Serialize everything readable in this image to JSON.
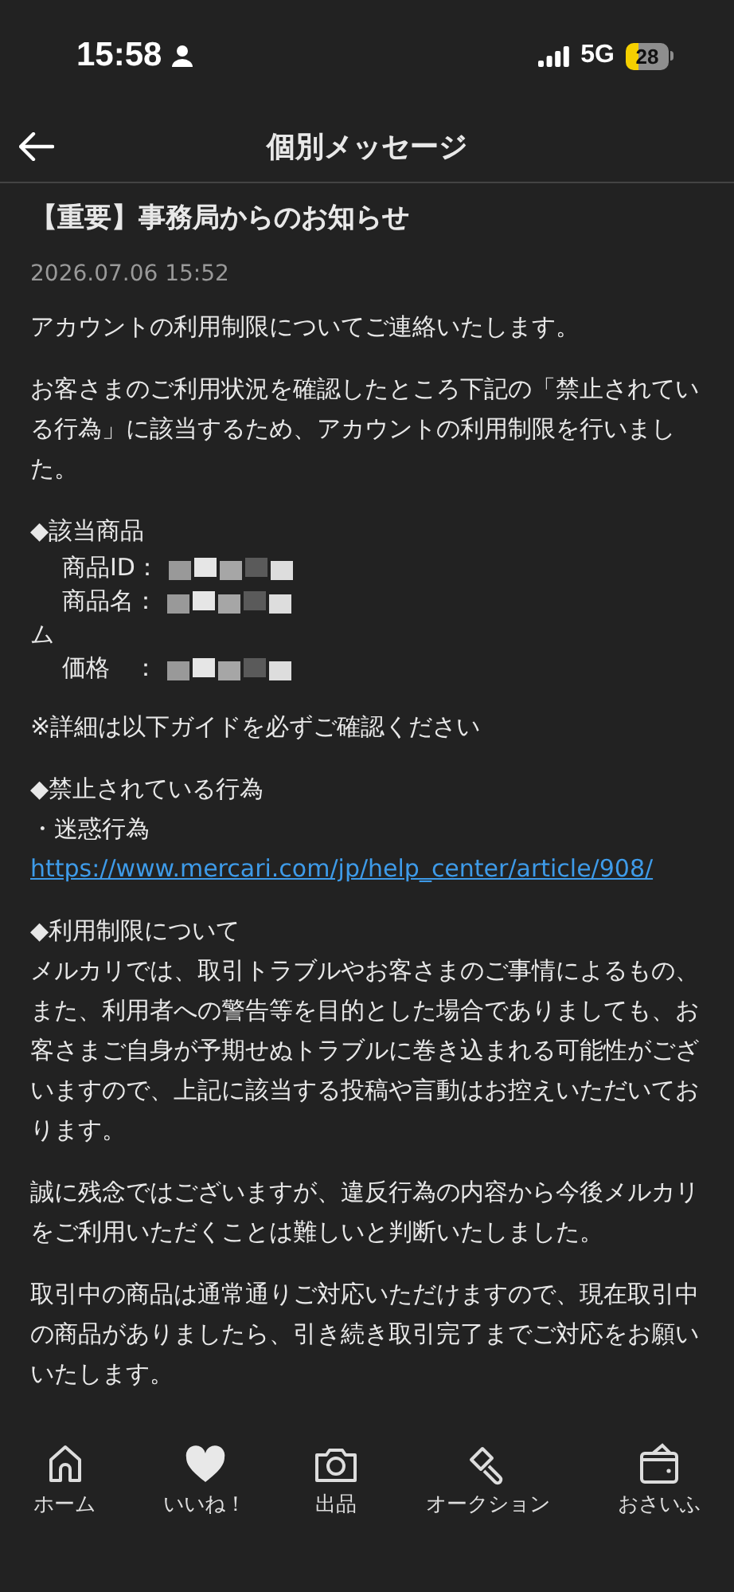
{
  "status_bar": {
    "time": "15:58",
    "network": "5G",
    "battery": "28"
  },
  "header": {
    "title": "個別メッセージ"
  },
  "message": {
    "title": "【重要】事務局からのお知らせ",
    "date": "2026.07.06 15:52",
    "blocks": [
      {
        "kind": "paragraph",
        "text": "アカウントの利用制限についてご連絡いたします。"
      },
      {
        "kind": "paragraph",
        "text": "お客さまのご利用状況を確認したところ下記の「禁止されている行為」に該当するため、アカウントの利用制限を行いました。"
      },
      {
        "kind": "details",
        "heading": "◆該当商品",
        "rows": [
          {
            "kind": "field",
            "label": "商品ID：",
            "redacted": true
          },
          {
            "kind": "field",
            "label": "商品名：",
            "redacted": true
          },
          {
            "kind": "continuation",
            "label": "ム",
            "redacted": false
          },
          {
            "kind": "field",
            "label": "価格　：",
            "redacted": true
          }
        ]
      },
      {
        "kind": "paragraph",
        "text": "※詳細は以下ガイドを必ずご確認ください"
      },
      {
        "kind": "section",
        "heading": "◆禁止されている行為",
        "text": "・迷惑行為",
        "link": "https://www.mercari.com/jp/help_center/article/908/"
      },
      {
        "kind": "section",
        "heading": "◆利用制限について",
        "text": "メルカリでは、取引トラブルやお客さまのご事情によるもの、また、利用者への警告等を目的とした場合でありましても、お客さまご自身が予期せぬトラブルに巻き込まれる可能性がございますので、上記に該当する投稿や言動はお控えいただいております。"
      },
      {
        "kind": "paragraph",
        "text": "誠に残念ではございますが、違反行為の内容から今後メルカリをご利用いただくことは難しいと判断いたしました。"
      },
      {
        "kind": "paragraph",
        "text": "取引中の商品は通常通りご対応いただけますので、現在取引中の商品がありましたら、引き続き取引完了までご対応をお願いいたします。"
      }
    ]
  },
  "tab_bar": [
    {
      "kind": "home",
      "label": "ホーム"
    },
    {
      "kind": "like",
      "label": "いいね！"
    },
    {
      "kind": "camera",
      "label": "出品"
    },
    {
      "kind": "auction",
      "label": "オークション"
    },
    {
      "kind": "wallet",
      "label": "おさいふ"
    }
  ]
}
